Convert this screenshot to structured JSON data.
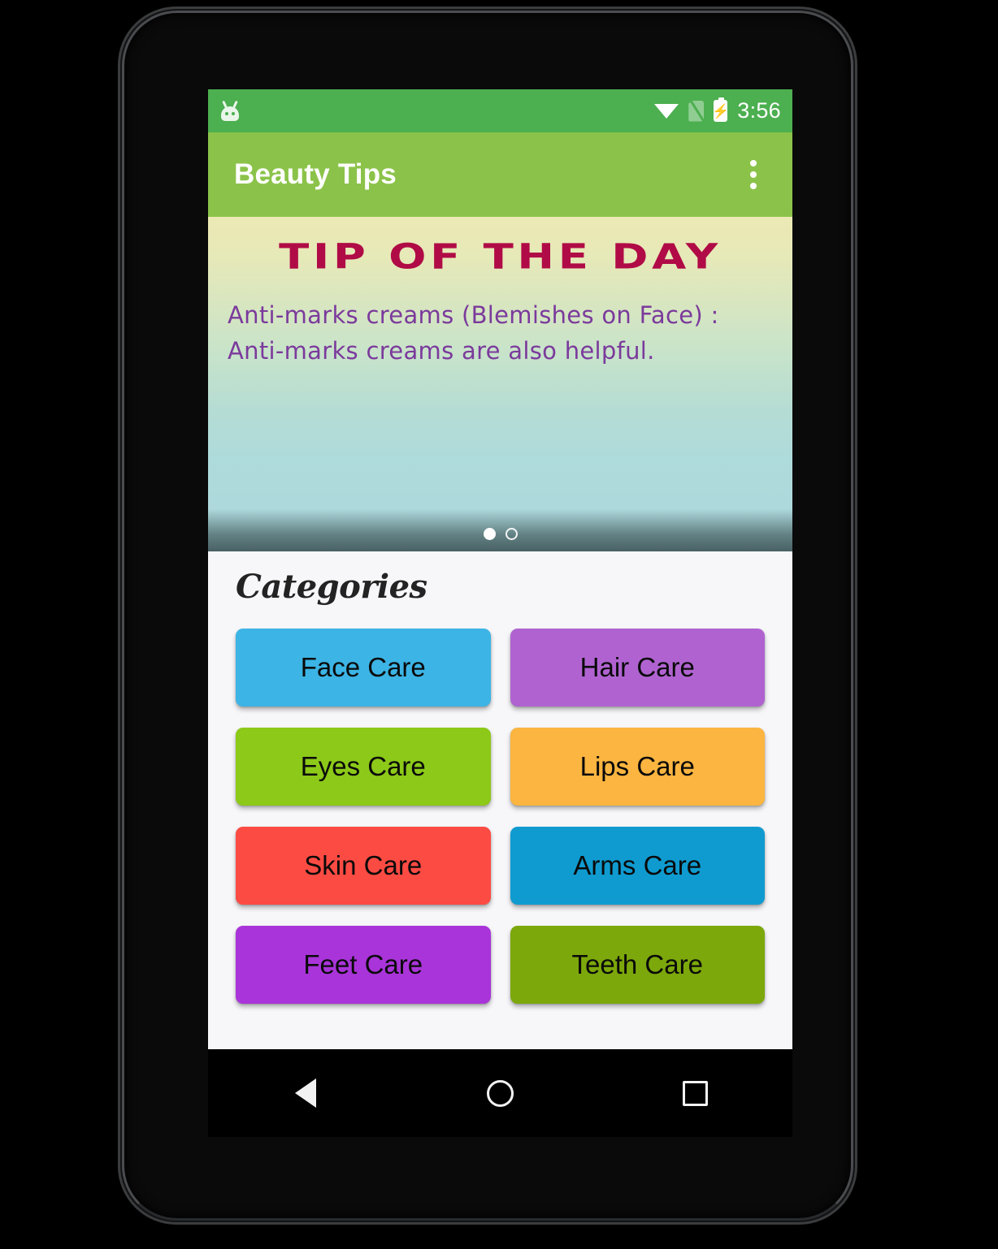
{
  "device": {
    "name": "android-phone-frame"
  },
  "status_bar": {
    "notification_icon": "android-head-icon",
    "wifi_icon": "wifi-icon",
    "sim_icon": "no-sim-icon",
    "battery_icon": "battery-charging-icon",
    "battery_bolt": "⚡",
    "time": "3:56",
    "background_color": "#4CAF50"
  },
  "app_bar": {
    "title": "Beauty Tips",
    "overflow_icon": "overflow-menu-icon",
    "background_color": "#8BC34A",
    "title_color": "#FFFFFF"
  },
  "tip_banner": {
    "title": "TIP OF THE DAY",
    "title_color": "#B00B46",
    "text": "Anti-marks creams (Blemishes on Face) : Anti-marks creams are also helpful.",
    "text_color": "#7B3A9C",
    "pager": {
      "total": 2,
      "active_index": 0
    }
  },
  "categories": {
    "heading": "Categories",
    "heading_color": "#232323",
    "items": [
      {
        "label": "Face Care",
        "color": "#3CB4E5"
      },
      {
        "label": "Hair Care",
        "color": "#B063D0"
      },
      {
        "label": "Eyes Care",
        "color": "#8CC919"
      },
      {
        "label": "Lips Care",
        "color": "#FBB540"
      },
      {
        "label": "Skin Care",
        "color": "#FC4B43"
      },
      {
        "label": "Arms Care",
        "color": "#0F9BD0"
      },
      {
        "label": "Feet Care",
        "color": "#A934D9"
      },
      {
        "label": "Teeth Care",
        "color": "#7CA80B"
      }
    ]
  },
  "nav_bar": {
    "back_icon": "back-triangle-icon",
    "home_icon": "home-circle-icon",
    "recents_icon": "recents-square-icon"
  }
}
